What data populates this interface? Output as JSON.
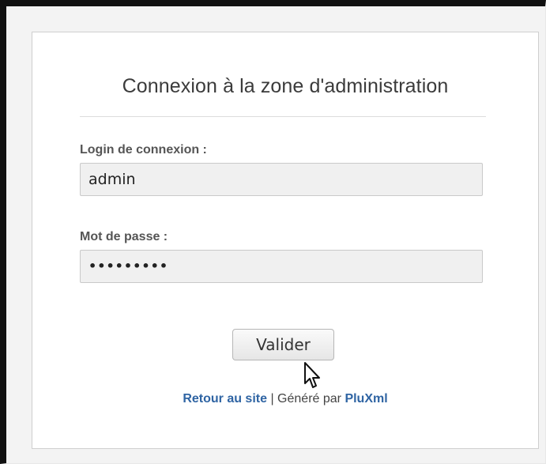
{
  "title": "Connexion à la zone d'administration",
  "form": {
    "login_label": "Login de connexion :",
    "login_value": "admin",
    "password_label": "Mot de passe :",
    "password_value": "•••••••••",
    "submit_label": "Valider"
  },
  "footer": {
    "back_link": "Retour au site",
    "separator": " | ",
    "generated_by": "Généré par ",
    "brand_link": "PluXml"
  },
  "colors": {
    "link": "#2f64a3",
    "title": "#3b3b3b",
    "window_border": "#111111"
  }
}
